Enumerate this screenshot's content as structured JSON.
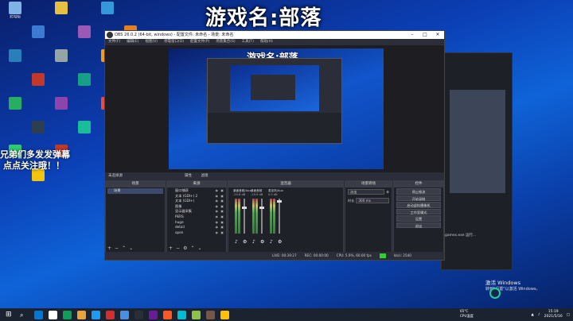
{
  "desktop": {
    "game_title": "游戏名:部落",
    "overlay_line1": "兄弟们多发发弹幕",
    "overlay_line2": "点点关注哦！！",
    "icons": [
      {
        "label": "此电脑",
        "color": "#7fb3e6"
      },
      {
        "label": "",
        "color": "#3c7bd1"
      },
      {
        "label": "",
        "color": "#e6c043"
      },
      {
        "label": "",
        "color": "#9b59b6"
      },
      {
        "label": "",
        "color": "#3498db"
      },
      {
        "label": "",
        "color": "#e67e22"
      },
      {
        "label": "",
        "color": "#2980b9"
      },
      {
        "label": "",
        "color": "#c0392b"
      },
      {
        "label": "",
        "color": "#95a5a6"
      },
      {
        "label": "",
        "color": "#16a085"
      },
      {
        "label": "",
        "color": "#f39c12"
      },
      {
        "label": "",
        "color": "#d35400"
      },
      {
        "label": "",
        "color": "#27ae60"
      },
      {
        "label": "",
        "color": "#2c3e50"
      },
      {
        "label": "",
        "color": "#8e44ad"
      },
      {
        "label": "",
        "color": "#1abc9c"
      },
      {
        "label": "",
        "color": "#e74c3c"
      },
      {
        "label": "",
        "color": "#34495e"
      },
      {
        "label": "",
        "color": "#2ecc71"
      },
      {
        "label": "",
        "color": "#f1c40f"
      },
      {
        "label": "",
        "color": "#c0392b"
      }
    ]
  },
  "bg_window": {
    "text": "games.exe 运行..."
  },
  "obs": {
    "title": "OBS 26.0.2 (64-bit, windows) - 配置文件: 未命名 - 场景: 未命名",
    "menu": [
      "文件(F)",
      "编辑(E)",
      "视图(V)",
      "停靠窗口(D)",
      "配置文件(P)",
      "场景集合(S)",
      "工具(T)",
      "帮助(H)"
    ],
    "preview_title": "游戏名:部落",
    "ctrlbar": [
      "属性",
      "滤镜"
    ],
    "ctrlbar_left": "未选择源",
    "docks": {
      "scenes": {
        "title": "场景",
        "items": [
          "场景"
        ]
      },
      "sources": {
        "title": "来源",
        "items": [
          "窗口捕获",
          "文本 (GDI+) 2",
          "文本 (GDI+)",
          "图像",
          "显示器采集",
          "PERS",
          "huge",
          "detail",
          "open"
        ]
      },
      "mixer": {
        "title": "混音器",
        "channels": [
          {
            "name": "桌面音频/Aux",
            "db": "-20.8 dB"
          },
          {
            "name": "桌面音频",
            "db": "-19.9 dB"
          },
          {
            "name": "麦克风/Aux",
            "db": "0.0 dB"
          }
        ]
      },
      "transitions": {
        "title": "场景转场",
        "type": "淡出",
        "duration_label": "时长",
        "duration": "300 ms"
      },
      "controls": {
        "title": "控件",
        "buttons": [
          "停止推流",
          "开始录制",
          "启动虚拟摄像机",
          "工作室模式",
          "设置",
          "退出"
        ]
      }
    },
    "status": {
      "live": "LIVE: 00:39:27",
      "rec": "REC: 00:00:00",
      "cpu": "CPU: 5.9%, 60.00 fps",
      "kbps": "kb/s: 2540"
    }
  },
  "activate_windows": {
    "title": "激活 Windows",
    "sub": "转到\"设置\"以激活 Windows。"
  },
  "taskbar": {
    "weather_temp": "65°C",
    "weather_label": "CPU温度",
    "time": "15:19",
    "date": "2021/5/16",
    "apps": [
      "#0078d4",
      "#ffffff",
      "#0f9d58",
      "#e8a43a",
      "#1d9bf0",
      "#d32f2f",
      "#4a90e2",
      "#2b2e38",
      "#6a1b9a",
      "#ff5722",
      "#00bcd4",
      "#8bc34a",
      "#795548",
      "#ffc107"
    ]
  }
}
